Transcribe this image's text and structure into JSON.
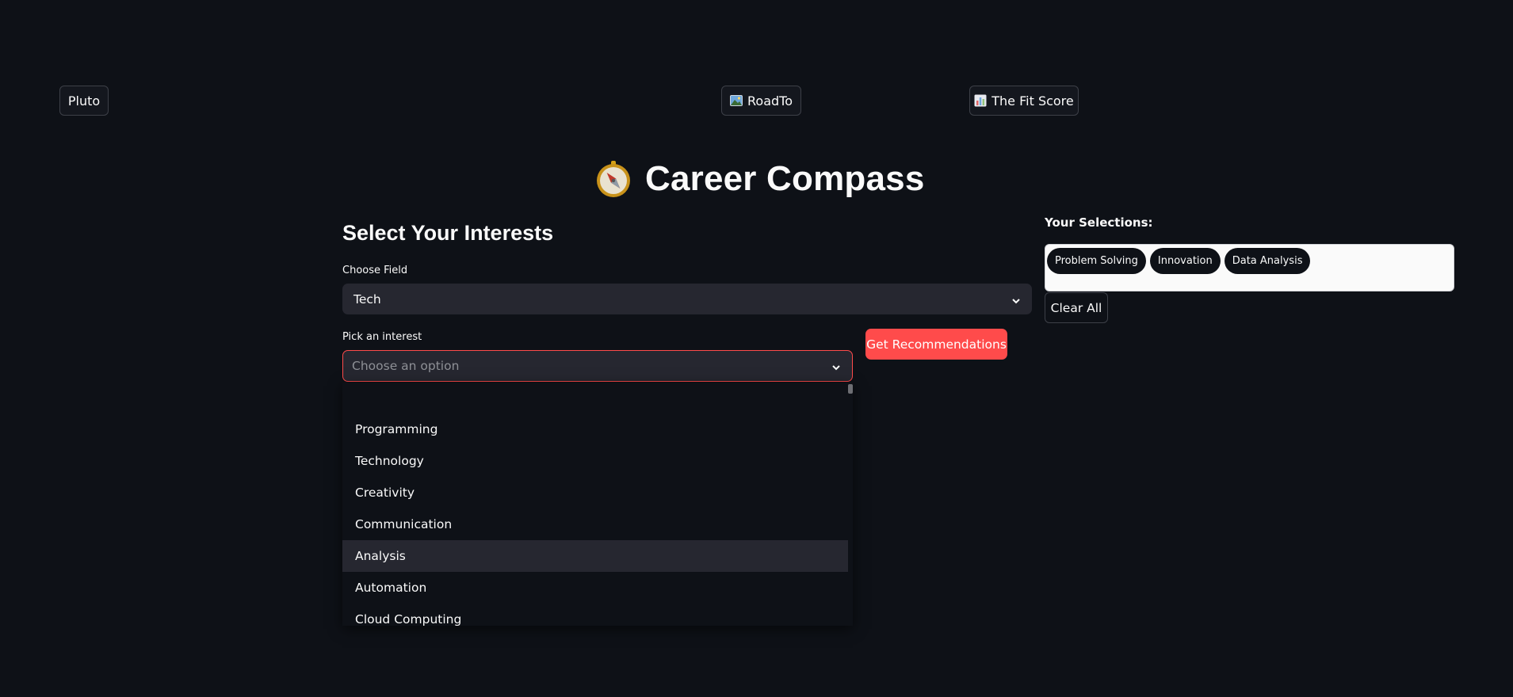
{
  "nav": {
    "pluto_label": "Pluto",
    "roadto_label": "RoadTo",
    "fitscore_label": "The Fit Score"
  },
  "title": "Career Compass",
  "icons": {
    "compass": "compass-icon",
    "roadto": "image-icon",
    "fitscore": "bar-chart-icon",
    "dropdown": "chevron-down-icon"
  },
  "interests": {
    "subheader": "Select Your Interests",
    "field_label": "Choose Field",
    "field_value": "Tech",
    "interest_label": "Pick an interest",
    "interest_placeholder": "Choose an option",
    "options": [
      "Programming",
      "Technology",
      "Creativity",
      "Communication",
      "Analysis",
      "Automation",
      "Cloud Computing"
    ],
    "highlighted_option": "Analysis",
    "recommend_label": "Get Recommendations"
  },
  "selections": {
    "label": "Your Selections:",
    "items": [
      "Problem Solving",
      "Innovation",
      "Data Analysis"
    ],
    "clear_label": "Clear All"
  },
  "colors": {
    "background": "#0e1117",
    "primary": "#ff4b4b",
    "input_bg": "#262730",
    "text": "#fafafa"
  }
}
